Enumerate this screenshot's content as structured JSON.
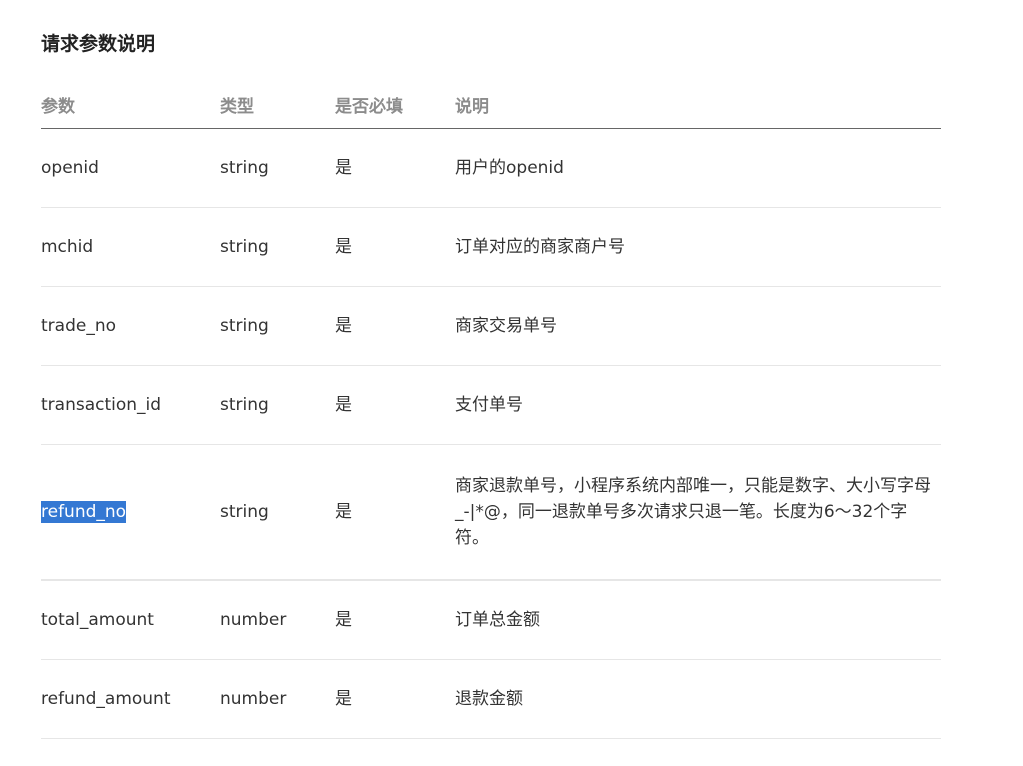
{
  "title": "请求参数说明",
  "table": {
    "headers": {
      "param": "参数",
      "type": "类型",
      "required": "是否必填",
      "description": "说明"
    },
    "rows": [
      {
        "param": "openid",
        "type": "string",
        "required": "是",
        "description": "用户的openid"
      },
      {
        "param": "mchid",
        "type": "string",
        "required": "是",
        "description": "订单对应的商家商户号"
      },
      {
        "param": "trade_no",
        "type": "string",
        "required": "是",
        "description": "商家交易单号"
      },
      {
        "param": "transaction_id",
        "type": "string",
        "required": "是",
        "description": "支付单号"
      },
      {
        "param": "refund_no",
        "type": "string",
        "required": "是",
        "description": "商家退款单号，小程序系统内部唯一，只能是数字、大小写字母_-|*@，同一退款单号多次请求只退一笔。长度为6～32个字符。",
        "selected": true
      },
      {
        "param": "total_amount",
        "type": "number",
        "required": "是",
        "description": "订单总金额"
      },
      {
        "param": "refund_amount",
        "type": "number",
        "required": "是",
        "description": "退款金额"
      }
    ]
  },
  "colors": {
    "selection": "#3478d3",
    "header_text": "#8c8c8c",
    "body_text": "#333333",
    "divider": "#e6e6e6"
  }
}
